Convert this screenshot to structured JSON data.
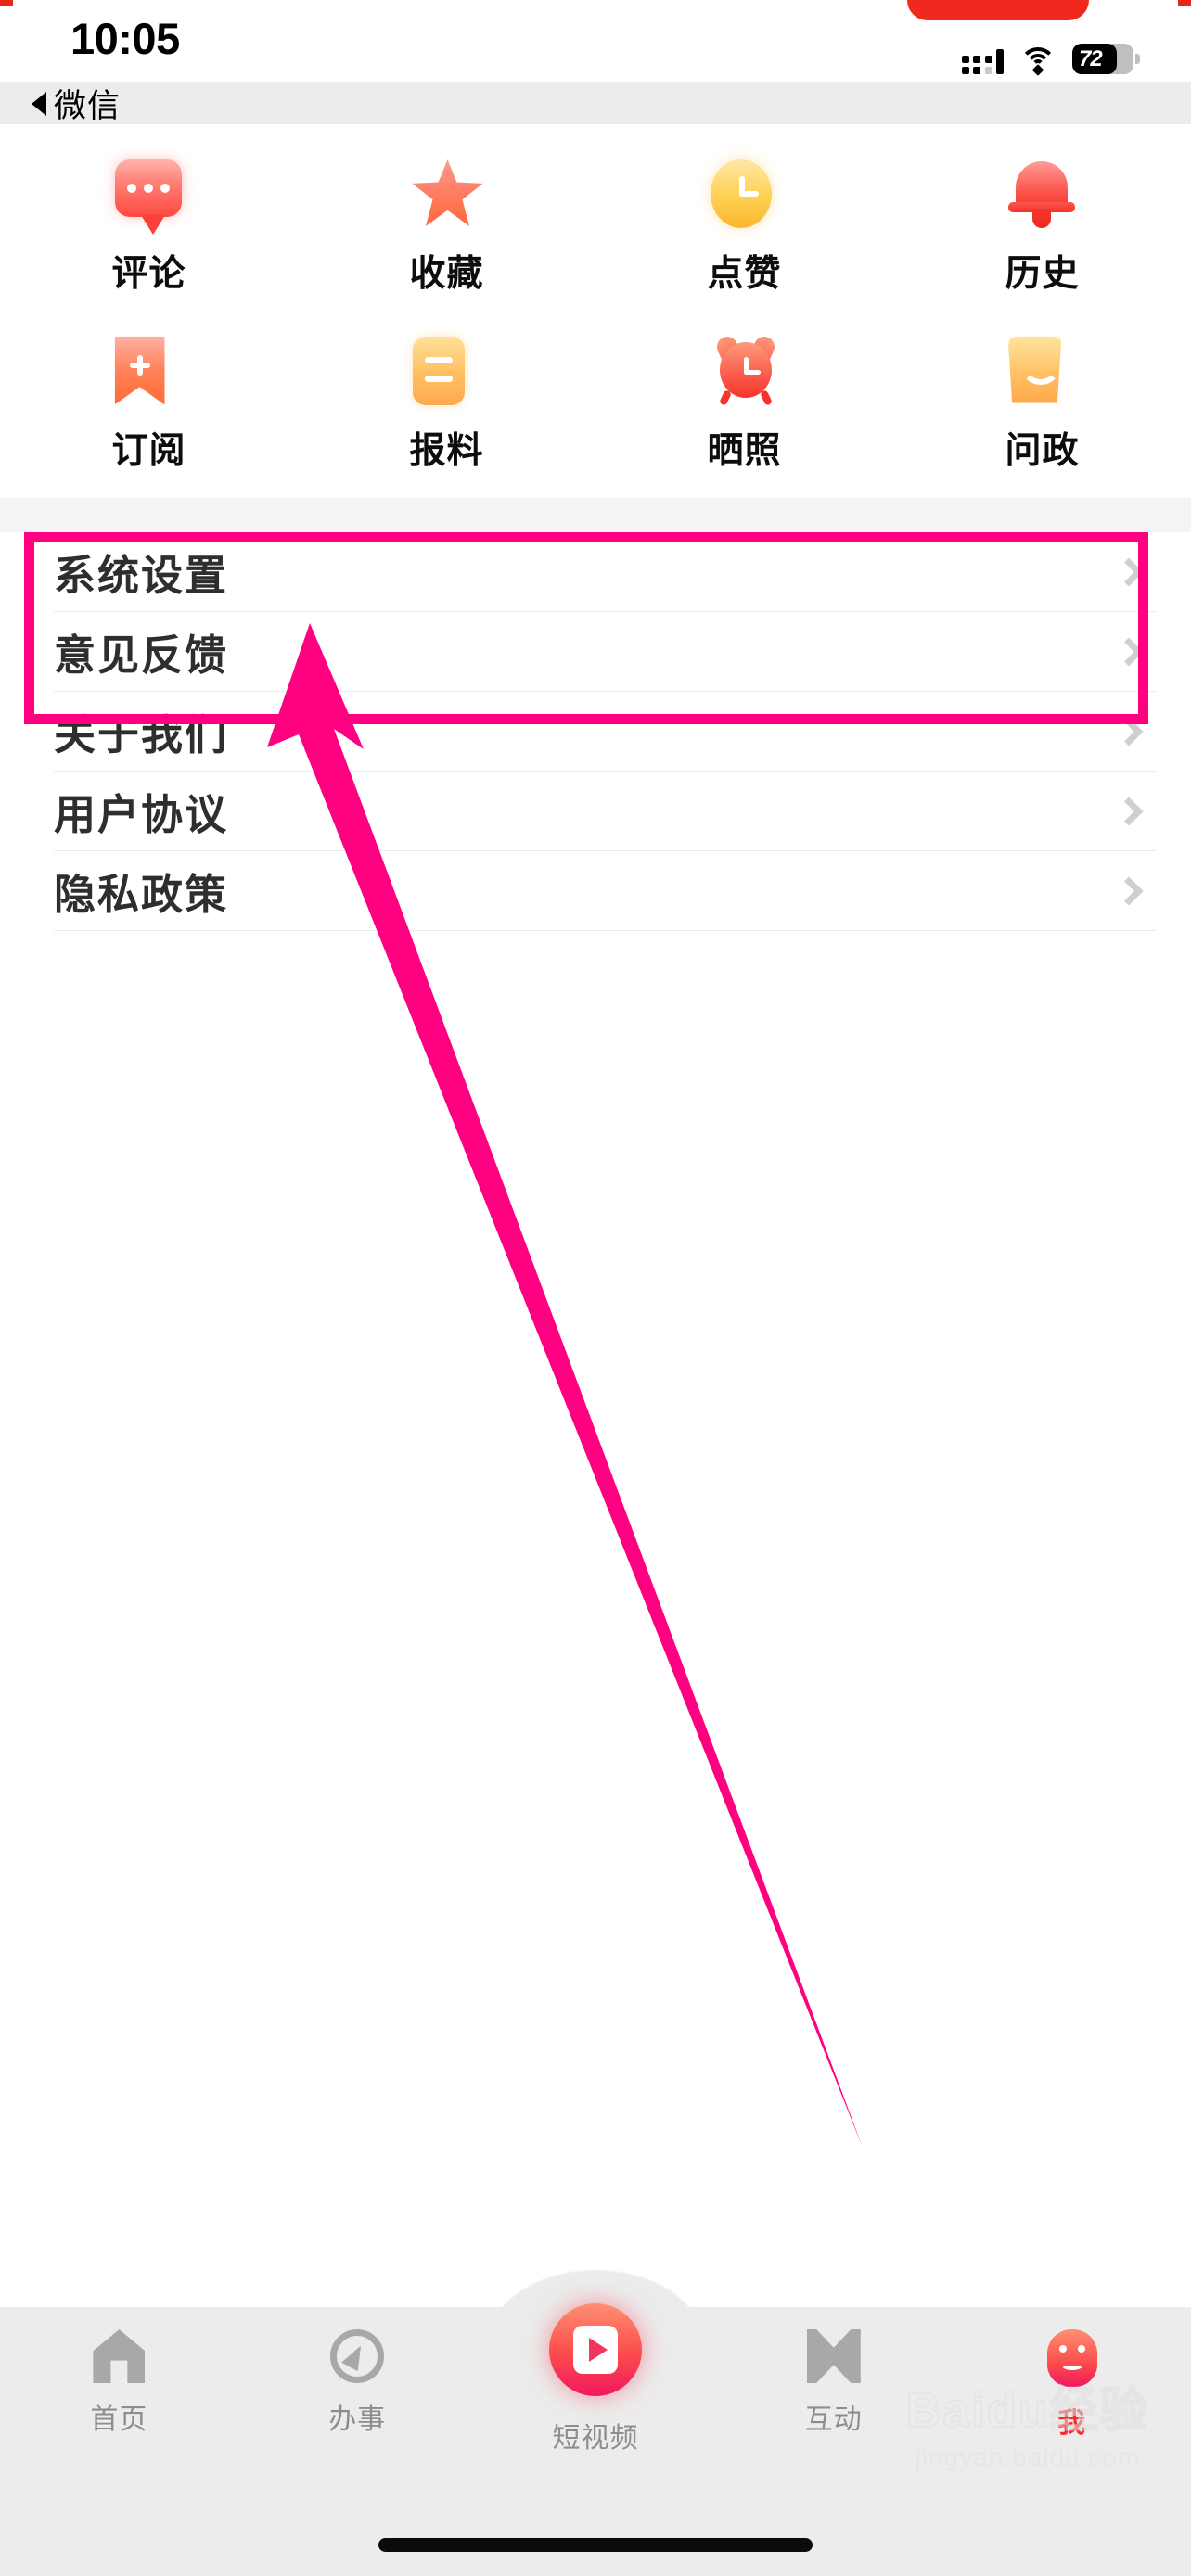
{
  "status_bar": {
    "time": "10:05",
    "battery_percent": "72",
    "signal_icon": "cellular-signal-icon",
    "wifi_icon": "wifi-icon",
    "battery_icon": "battery-icon"
  },
  "back_nav": {
    "label": "微信",
    "icon": "back-triangle-icon"
  },
  "feature_grid": [
    {
      "label": "评论",
      "icon": "comment-bubble-icon"
    },
    {
      "label": "收藏",
      "icon": "star-icon"
    },
    {
      "label": "点赞",
      "icon": "clock-icon"
    },
    {
      "label": "历史",
      "icon": "bell-icon"
    },
    {
      "label": "订阅",
      "icon": "bookmark-plus-icon"
    },
    {
      "label": "报料",
      "icon": "document-lines-icon"
    },
    {
      "label": "晒照",
      "icon": "alarm-clock-icon"
    },
    {
      "label": "问政",
      "icon": "shopping-bag-icon"
    }
  ],
  "menu": {
    "items": [
      {
        "label": "系统设置",
        "chevron": "chevron-right-icon",
        "highlighted": true
      },
      {
        "label": "意见反馈",
        "chevron": "chevron-right-icon",
        "highlighted": false
      },
      {
        "label": "关于我们",
        "chevron": "chevron-right-icon",
        "highlighted": false
      },
      {
        "label": "用户协议",
        "chevron": "chevron-right-icon",
        "highlighted": false
      },
      {
        "label": "隐私政策",
        "chevron": "chevron-right-icon",
        "highlighted": false
      }
    ]
  },
  "annotation": {
    "highlight_color": "#ff0080",
    "arrow_color": "#ff0080",
    "target_label": "系统设置"
  },
  "tab_bar": {
    "items": [
      {
        "label": "首页",
        "icon": "home-icon",
        "active": false
      },
      {
        "label": "办事",
        "icon": "compass-icon",
        "active": false
      },
      {
        "label": "短视频",
        "icon": "video-play-icon",
        "active": false
      },
      {
        "label": "互动",
        "icon": "interaction-x-icon",
        "active": false
      },
      {
        "label": "我",
        "icon": "smiley-face-icon",
        "active": true
      }
    ],
    "active_color": "#fa2b2b",
    "inactive_color": "#8d8d8d"
  },
  "watermark": {
    "brand": "Baidu经验",
    "url": "jingyan.baidu.com"
  }
}
